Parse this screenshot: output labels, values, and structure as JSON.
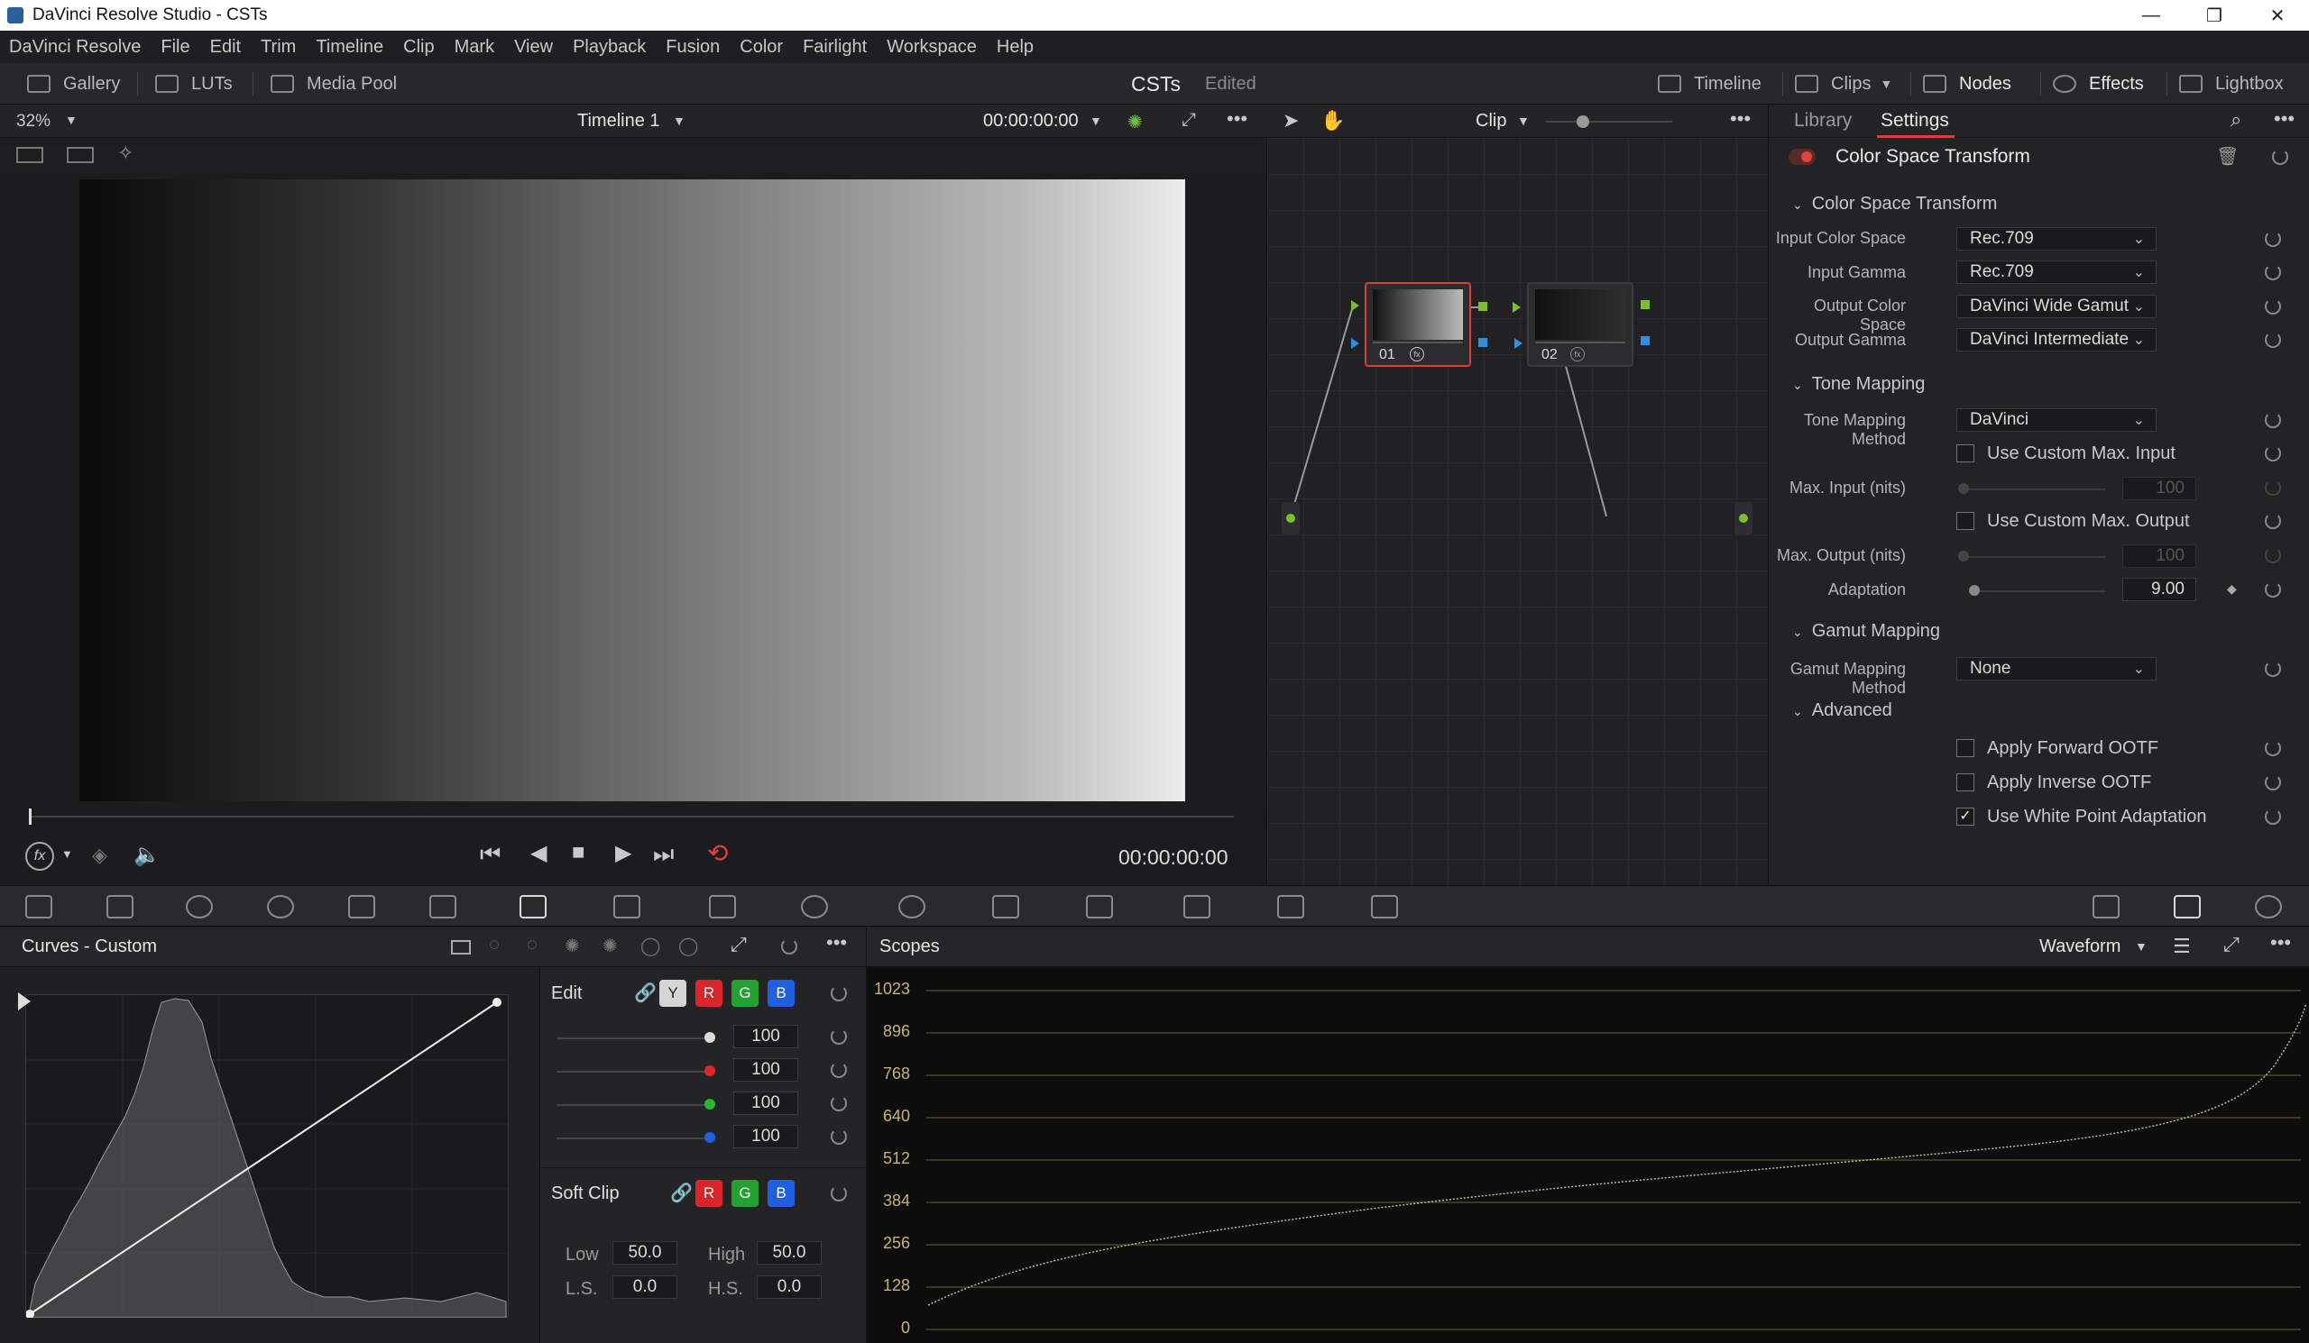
{
  "window": {
    "title": "DaVinci Resolve Studio - CSTs"
  },
  "menu": [
    "DaVinci Resolve",
    "File",
    "Edit",
    "Trim",
    "Timeline",
    "Clip",
    "Mark",
    "View",
    "Playback",
    "Fusion",
    "Color",
    "Fairlight",
    "Workspace",
    "Help"
  ],
  "toolbar": {
    "gallery": "Gallery",
    "luts": "LUTs",
    "media_pool": "Media Pool",
    "project": "CSTs",
    "status": "Edited",
    "timeline": "Timeline",
    "clips": "Clips",
    "nodes": "Nodes",
    "effects": "Effects",
    "lightbox": "Lightbox"
  },
  "viewer": {
    "zoom": "32%",
    "timeline_name": "Timeline 1",
    "timecode_top": "00:00:00:00",
    "timecode_bottom": "00:00:00:00"
  },
  "nodes": {
    "mode": "Clip",
    "node1": "01",
    "node2": "02"
  },
  "inspector": {
    "tab_library": "Library",
    "tab_settings": "Settings",
    "effect_title": "Color Space Transform",
    "sec_cst": "Color Space Transform",
    "input_cs_label": "Input Color Space",
    "input_cs": "Rec.709",
    "input_gamma_label": "Input Gamma",
    "input_gamma": "Rec.709",
    "output_cs_label": "Output Color Space",
    "output_cs": "DaVinci Wide Gamut",
    "output_gamma_label": "Output Gamma",
    "output_gamma": "DaVinci Intermediate",
    "sec_tone": "Tone Mapping",
    "tone_method_label": "Tone Mapping Method",
    "tone_method": "DaVinci",
    "custom_max_input": "Use Custom Max. Input",
    "max_input_label": "Max. Input (nits)",
    "max_input": "100",
    "custom_max_output": "Use Custom Max. Output",
    "max_output_label": "Max. Output (nits)",
    "max_output": "100",
    "adaptation_label": "Adaptation",
    "adaptation": "9.00",
    "sec_gamut": "Gamut Mapping",
    "gamut_method_label": "Gamut Mapping Method",
    "gamut_method": "None",
    "sec_advanced": "Advanced",
    "fwd_ootf": "Apply Forward OOTF",
    "inv_ootf": "Apply Inverse OOTF",
    "white_point": "Use White Point Adaptation",
    "white_point_checked": true
  },
  "curves": {
    "title": "Curves - Custom",
    "edit_label": "Edit",
    "ch_y": "Y",
    "ch_r": "R",
    "ch_g": "G",
    "ch_b": "B",
    "val_y": "100",
    "val_r": "100",
    "val_g": "100",
    "val_b": "100",
    "soft_clip": "Soft Clip",
    "low_label": "Low",
    "low": "50.0",
    "high_label": "High",
    "high": "50.0",
    "ls_label": "L.S.",
    "ls": "0.0",
    "hs_label": "H.S.",
    "hs": "0.0"
  },
  "scopes": {
    "title": "Scopes",
    "mode": "Waveform",
    "scale": [
      "1023",
      "896",
      "768",
      "640",
      "512",
      "384",
      "256",
      "128",
      "0"
    ]
  },
  "colors": {
    "accent_red": "#d8403a",
    "scope_line": "#8f7a3e",
    "node_green": "#7bbf2a",
    "node_blue": "#2f8fe0"
  }
}
